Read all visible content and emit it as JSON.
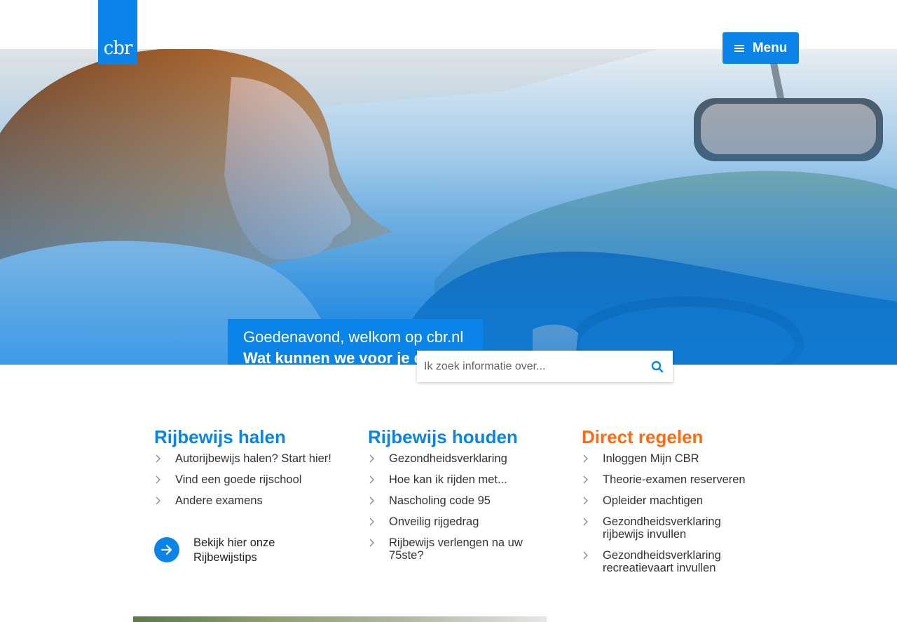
{
  "header": {
    "logo_text": "cbr",
    "menu_label": "Menu"
  },
  "hero": {
    "greeting": "Goedenavond, welkom op cbr.nl",
    "question": "Wat kunnen we voor je doen?"
  },
  "search": {
    "placeholder": "Ik zoek informatie over..."
  },
  "columns": [
    {
      "title": "Rijbewijs halen",
      "items": [
        "Autorijbewijs halen? Start hier!",
        "Vind een goede rijschool",
        "Andere examens"
      ]
    },
    {
      "title": "Rijbewijs houden",
      "items": [
        "Gezondheidsverklaring",
        "Hoe kan ik rijden met...",
        "Nascholing code 95",
        "Onveilig rijgedrag",
        "Rijbewijs verlengen na uw 75ste?"
      ]
    },
    {
      "title": "Direct regelen",
      "items": [
        "Inloggen Mijn CBR",
        "Theorie-examen reserveren",
        "Opleider machtigen",
        "Gezondheidsverklaring rijbewijs invullen",
        "Gezondheidsverklaring recreatievaart invullen"
      ]
    }
  ],
  "tips": {
    "label": "Bekijk hier onze Rijbewijstips"
  },
  "colors": {
    "brand_blue": "#0a84e8",
    "accent_orange": "#ff6a13"
  },
  "icons": {
    "menu": "hamburger-icon",
    "search": "search-icon",
    "list": "chevron-right-icon",
    "tips": "arrow-right-icon"
  }
}
